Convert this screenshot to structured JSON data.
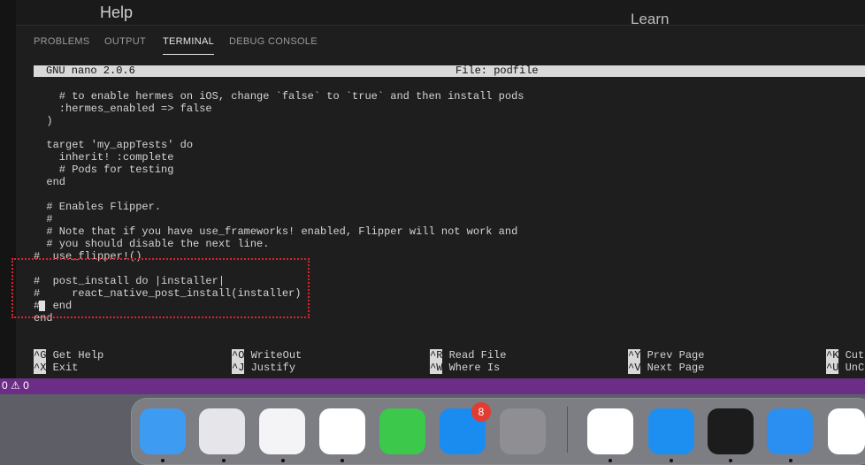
{
  "menu": {
    "help": "Help",
    "learn": "Learn"
  },
  "panel": {
    "tabs": [
      {
        "label": "PROBLEMS"
      },
      {
        "label": "OUTPUT"
      },
      {
        "label": "TERMINAL"
      },
      {
        "label": "DEBUG CONSOLE"
      }
    ],
    "active_tab": "TERMINAL"
  },
  "terminal": {
    "header_version": "GNU nano 2.0.6",
    "header_file": "File: podfile",
    "lines": [
      "    # to enable hermes on iOS, change `false` to `true` and then install pods",
      "    :hermes_enabled => false",
      "  )",
      "",
      "  target 'my_appTests' do",
      "    inherit! :complete",
      "    # Pods for testing",
      "  end",
      "",
      "  # Enables Flipper.",
      "  #",
      "  # Note that if you have use_frameworks! enabled, Flipper will not work and",
      "  # you should disable the next line.",
      "#  use_flipper!()",
      "",
      "#  post_install do |installer|",
      "#     react_native_post_install(installer)",
      "#  end",
      "end"
    ],
    "shortcuts": [
      {
        "key": "^G",
        "label": "Get Help"
      },
      {
        "key": "^X",
        "label": "Exit"
      },
      {
        "key": "^O",
        "label": "WriteOut"
      },
      {
        "key": "^J",
        "label": "Justify"
      },
      {
        "key": "^R",
        "label": "Read File"
      },
      {
        "key": "^W",
        "label": "Where Is"
      },
      {
        "key": "^Y",
        "label": "Prev Page"
      },
      {
        "key": "^V",
        "label": "Next Page"
      },
      {
        "key": "^K",
        "label": "Cut"
      },
      {
        "key": "^U",
        "label": "UnCu"
      }
    ]
  },
  "status_bar": {
    "text": "0 ⚠ 0"
  },
  "dock": {
    "apps": [
      {
        "name": "finder-app-icon",
        "color": "#3e9bf2"
      },
      {
        "name": "launchpad-app-icon",
        "color": "#e5e5ea"
      },
      {
        "name": "safari-app-icon",
        "color": "#f4f4f6"
      },
      {
        "name": "chrome-app-icon",
        "color": "#ffffff"
      },
      {
        "name": "facetime-app-icon",
        "color": "#3cc84a"
      },
      {
        "name": "app-store-app-icon",
        "color": "#1a8cf0"
      },
      {
        "name": "system-preferences-app-icon",
        "color": "#8e8e93"
      },
      {
        "name": "teamviewer-app-icon",
        "color": "#ffffff"
      },
      {
        "name": "simulator-app-icon",
        "color": "#1d8ff1"
      },
      {
        "name": "terminal-app-icon",
        "color": "#1c1c1c"
      },
      {
        "name": "xcode-app-icon",
        "color": "#2a8ff0"
      },
      {
        "name": "vscode-app-icon",
        "color": "#ffffff"
      }
    ],
    "app_store_badge": "8"
  },
  "colors": {
    "status_bar": "#6c2d86",
    "highlight_box": "#e0222a",
    "nano_header": "#d9d9d9"
  }
}
